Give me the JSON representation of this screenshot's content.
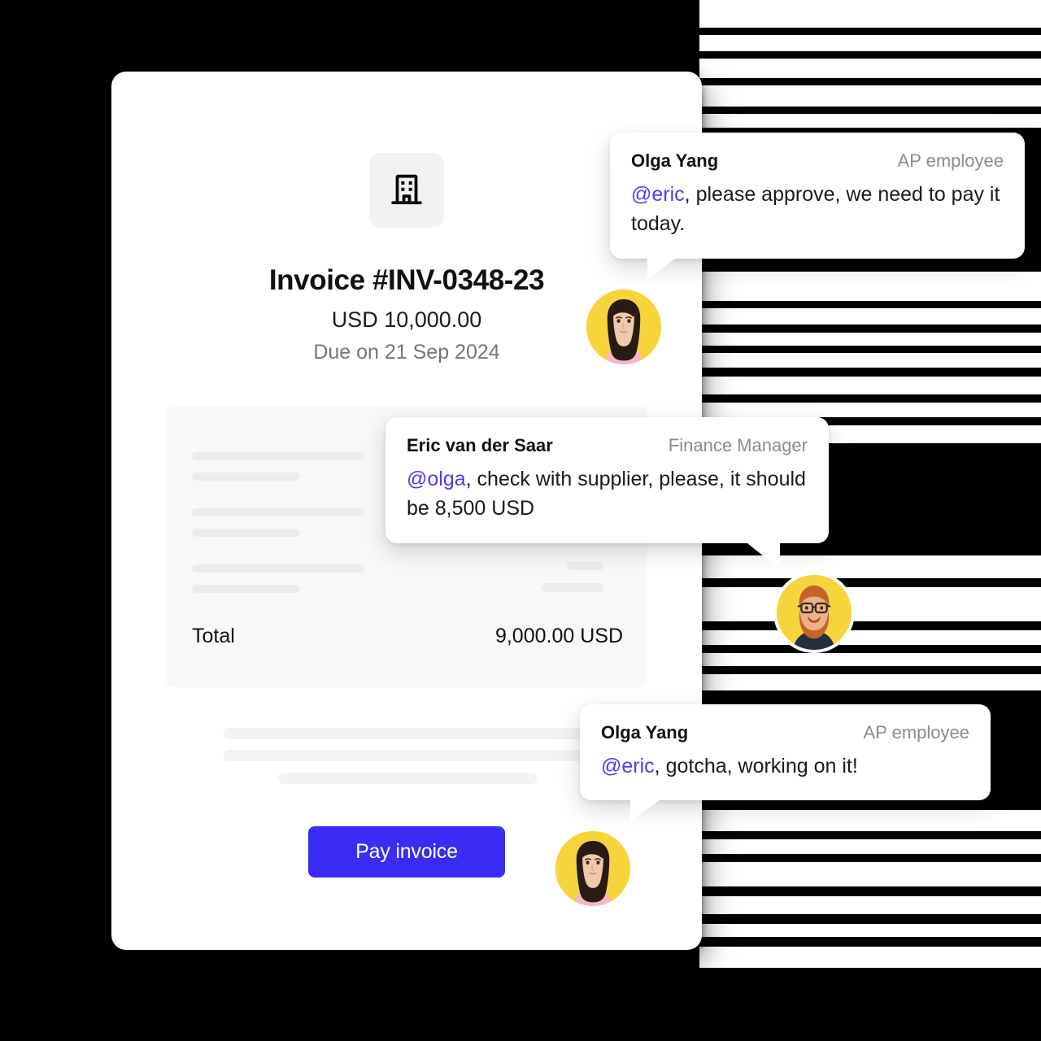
{
  "invoice": {
    "logo_icon": "office-building-icon",
    "title": "Invoice #INV-0348-23",
    "amount": "USD 10,000.00",
    "due": "Due on 21 Sep 2024",
    "total_label": "Total",
    "total_value": "9,000.00 USD",
    "pay_button_label": "Pay invoice",
    "accent_color": "#3a2cf5",
    "panel_color": "#f8f8f8",
    "skeleton_color": "#ececec"
  },
  "comments": [
    {
      "author": "Olga Yang",
      "role": "AP employee",
      "mention": "@eric",
      "text": ", please approve, we need to pay it today.",
      "avatar": "olga-avatar",
      "mention_color": "#4b3bf5"
    },
    {
      "author": "Eric van der Saar",
      "role": "Finance Manager",
      "mention": "@olga",
      "text": ", check with supplier, please, it should be 8,500 USD",
      "avatar": "eric-avatar",
      "mention_color": "#4b3bf5"
    },
    {
      "author": "Olga Yang",
      "role": "AP employee",
      "mention": "@eric",
      "text": ", gotcha, working on it!",
      "avatar": "olga-avatar",
      "mention_color": "#4b3bf5"
    }
  ]
}
